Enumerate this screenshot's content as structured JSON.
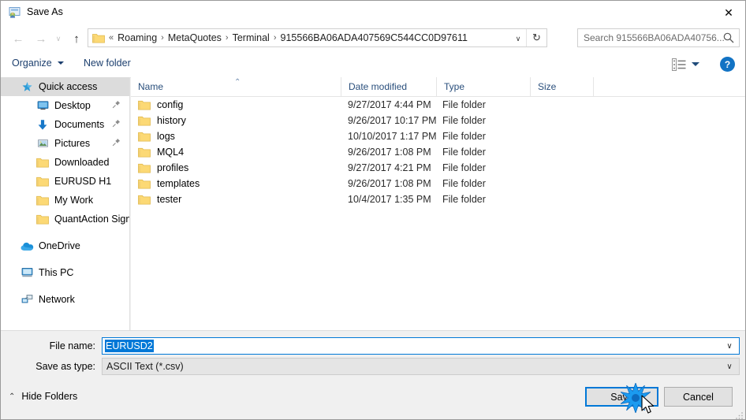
{
  "window": {
    "title": "Save As",
    "title_icon": "save-as-icon",
    "close_label": "✕"
  },
  "nav": {
    "back_icon": "arrow-left-icon",
    "forward_icon": "arrow-right-icon",
    "recent_icon": "chevron-down-icon",
    "up_icon": "arrow-up-icon",
    "back_label": "←",
    "forward_label": "→",
    "recent_label": "∨",
    "up_label": "↑"
  },
  "address": {
    "overflow_label": "«",
    "separator": "›",
    "crumbs": [
      "Roaming",
      "MetaQuotes",
      "Terminal",
      "915566BA06ADA407569C544CC0D97611"
    ],
    "chevron_label": "∨",
    "refresh_label": "↻"
  },
  "search": {
    "placeholder": "Search 915566BA06ADA40756...",
    "value": ""
  },
  "commandbar": {
    "organize_label": "Organize",
    "new_folder_label": "New folder",
    "view_mode_icon": "list-view-icon",
    "help_label": "?"
  },
  "sidebar": {
    "items": [
      {
        "label": "Quick access",
        "icon": "star-icon",
        "level": 0,
        "selected": true,
        "pinned": false
      },
      {
        "label": "Desktop",
        "icon": "desktop-icon",
        "level": 1,
        "selected": false,
        "pinned": true
      },
      {
        "label": "Documents",
        "icon": "documents-icon",
        "level": 1,
        "selected": false,
        "pinned": true
      },
      {
        "label": "Pictures",
        "icon": "pictures-icon",
        "level": 1,
        "selected": false,
        "pinned": true
      },
      {
        "label": "Downloaded",
        "icon": "folder-icon",
        "level": 1,
        "selected": false,
        "pinned": false
      },
      {
        "label": "EURUSD H1",
        "icon": "folder-icon",
        "level": 1,
        "selected": false,
        "pinned": false
      },
      {
        "label": "My Work",
        "icon": "folder-icon",
        "level": 1,
        "selected": false,
        "pinned": false
      },
      {
        "label": "QuantAction Signal",
        "icon": "folder-icon",
        "level": 1,
        "selected": false,
        "pinned": false
      },
      {
        "label": "OneDrive",
        "icon": "onedrive-icon",
        "level": 0,
        "selected": false,
        "pinned": false,
        "gap_before": true
      },
      {
        "label": "This PC",
        "icon": "this-pc-icon",
        "level": 0,
        "selected": false,
        "pinned": false,
        "gap_before": true
      },
      {
        "label": "Network",
        "icon": "network-icon",
        "level": 0,
        "selected": false,
        "pinned": false,
        "gap_before": true
      }
    ]
  },
  "filelist": {
    "columns": [
      "Name",
      "Date modified",
      "Type",
      "Size"
    ],
    "sort_column": "Name",
    "sort_caret": "⌃",
    "rows": [
      {
        "name": "config",
        "date": "9/27/2017 4:44 PM",
        "type": "File folder",
        "size": ""
      },
      {
        "name": "history",
        "date": "9/26/2017 10:17 PM",
        "type": "File folder",
        "size": ""
      },
      {
        "name": "logs",
        "date": "10/10/2017 1:17 PM",
        "type": "File folder",
        "size": ""
      },
      {
        "name": "MQL4",
        "date": "9/26/2017 1:08 PM",
        "type": "File folder",
        "size": ""
      },
      {
        "name": "profiles",
        "date": "9/27/2017 4:21 PM",
        "type": "File folder",
        "size": ""
      },
      {
        "name": "templates",
        "date": "9/26/2017 1:08 PM",
        "type": "File folder",
        "size": ""
      },
      {
        "name": "tester",
        "date": "10/4/2017 1:35 PM",
        "type": "File folder",
        "size": ""
      }
    ]
  },
  "form": {
    "filename_label": "File name:",
    "filename_value": "EURUSD2",
    "savetype_label": "Save as type:",
    "savetype_value": "ASCII Text (*.csv)",
    "combo_chevron": "∨",
    "hide_folders_label": "Hide Folders",
    "hide_folders_caret": "⌃",
    "save_label": "Save",
    "cancel_label": "Cancel"
  },
  "colors": {
    "accent": "#0078d7",
    "folder_yellow": "#fcd975",
    "command_link": "#1c3f6e",
    "column_header": "#2a4f7c",
    "selection_gray": "#dcdcdc"
  }
}
